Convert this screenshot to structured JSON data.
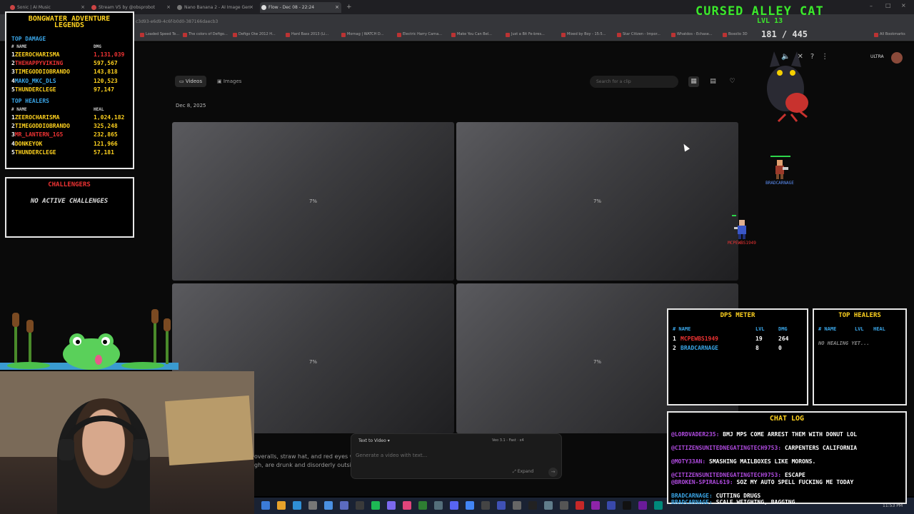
{
  "browser": {
    "tabs": [
      {
        "label": "Sonic | AI Music",
        "active": false
      },
      {
        "label": "Stream V5 by @obsprobot",
        "active": false
      },
      {
        "label": "Nano Banana 2 - AI Image Gen",
        "active": false
      },
      {
        "label": "Flow - Dec 08 - 22:24",
        "active": true
      }
    ],
    "url": "c3d93-e6d9-4c6f-b0d0-387166daecb3",
    "bookmarks": [
      "Loaded Speed Te...",
      "The colors of Defigo...",
      "Defigo Oiw 2012 H...",
      "Hard Bass 2013 (Li...",
      "Mornag | WATCH D...",
      "Electric Harry Carna...",
      "Make You Can Bel...",
      "Just a Bit Fe-bres...",
      "Mixed by Boy - 15:5...",
      "Star Citizen - Impor...",
      "Whatdos - Echase...",
      "Boxolio 3D"
    ],
    "all_bookmarks": "All Bookmarks"
  },
  "flow": {
    "tab_videos": "Videos",
    "tab_images": "Images",
    "search_placeholder": "Search for a clip",
    "date": "Dec 8, 2025",
    "tiles": [
      {
        "progress": "7%"
      },
      {
        "progress": "7%"
      },
      {
        "progress": "7%"
      },
      {
        "progress": "7%"
      }
    ],
    "composer": {
      "mode": "Text to Video",
      "model": "Veo 3.1 - Fast",
      "count": "x4",
      "placeholder": "Generate a video with text...",
      "expand": "Expand"
    },
    "prompt_snippet_1": "overalls, straw hat, and red eyes with",
    "prompt_snippet_2": "gh, are drunk and disorderly outside c",
    "plan_badge": "ULTRA"
  },
  "legends": {
    "title_1": "BONGWATER ADVENTURE",
    "title_2": "LEGENDS",
    "top_damage_title": "TOP DAMAGE",
    "damage_cols": {
      "name": "# NAME",
      "value": "DMG"
    },
    "top_damage": [
      {
        "rank": "1",
        "name": "ZEEROCHARISMA",
        "value": "1,131,039"
      },
      {
        "rank": "2",
        "name": "THEHAPPYVIKING",
        "value": "597,567"
      },
      {
        "rank": "3",
        "name": "TIMEGODDIOBRANDO",
        "value": "143,818"
      },
      {
        "rank": "4",
        "name": "MAKO_MKC_DLS",
        "value": "120,523"
      },
      {
        "rank": "5",
        "name": "THUNDERCLEGE",
        "value": "97,147"
      }
    ],
    "top_healers_title": "TOP HEALERS",
    "heal_cols": {
      "name": "# NAME",
      "value": "HEAL"
    },
    "top_healers": [
      {
        "rank": "1",
        "name": "ZEEROCHARISMA",
        "value": "1,024,182"
      },
      {
        "rank": "2",
        "name": "TIMEGODDIOBRANDO",
        "value": "325,248"
      },
      {
        "rank": "3",
        "name": "MR_LANTERN_1G5",
        "value": "232,865"
      },
      {
        "rank": "4",
        "name": "DONKEYOK",
        "value": "121,966"
      },
      {
        "rank": "5",
        "name": "THUNDERCLEGE",
        "value": "57,181"
      }
    ]
  },
  "challengers": {
    "title": "CHALLENGERS",
    "empty": "NO ACTIVE CHALLENGES"
  },
  "boss": {
    "name": "CURSED ALLEY CAT",
    "level": "LVL 13",
    "hp": "181 / 445"
  },
  "players": [
    {
      "name": "BRADCARNAGE"
    },
    {
      "name": "MCPEWBS1949"
    }
  ],
  "dps_meter": {
    "title": "DPS METER",
    "cols": {
      "name": "# NAME",
      "lvl": "LVL",
      "dmg": "DMG"
    },
    "rows": [
      {
        "rank": "1",
        "name": "MCPEWBS1949",
        "lvl": "19",
        "dmg": "264"
      },
      {
        "rank": "2",
        "name": "BRADCARNAGE",
        "lvl": "8",
        "dmg": "0"
      }
    ]
  },
  "top_healers_live": {
    "title": "TOP HEALERS",
    "cols": {
      "name": "# NAME",
      "lvl": "LVL",
      "heal": "HEAL"
    },
    "empty": "NO HEALING YET..."
  },
  "chat": {
    "title": "CHAT LOG",
    "lines": [
      {
        "user": "@LORDVADER235:",
        "text": "BMJ MPS COME ARREST THEM WITH DONUT LOL"
      },
      {
        "user": "@CITIZENSUNITEDNEGATINGTECH9753:",
        "text": "CARPENTERS CALIFORNIA"
      },
      {
        "user": "@MOTY33AN:",
        "text": "SMASHING MAILBOXES LIKE MORONS."
      },
      {
        "user": "@CITIZENSUNITEDNEGATINGTECH9753:",
        "text": "ESCAPE"
      },
      {
        "user": "@BROKEN-SPIRAL619:",
        "text": "SOZ MY AUTO SPELL FUCKING ME TODAY"
      },
      {
        "user": "BRADCARNAGE:",
        "text": "CUTTING DRUGS"
      },
      {
        "user": "BRADCARNAGE:",
        "text": "SCALE WEIGHING, BAGGING"
      }
    ]
  },
  "taskbar": {
    "time": "11:53 PM"
  },
  "colors": {
    "gold": "#ffd21f",
    "green": "#3be82b",
    "damage_red": "#e33",
    "blue": "#3aa6e8",
    "chat_user": "#b04be0"
  }
}
